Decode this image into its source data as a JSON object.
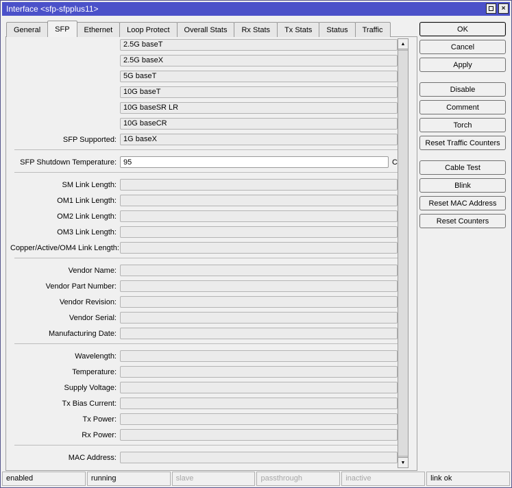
{
  "window": {
    "title": "Interface <sfp-sfpplus11>",
    "controls": {
      "close_glyph": "×"
    }
  },
  "icons": {
    "scroll_up": "▲",
    "scroll_down": "▼"
  },
  "tabs": {
    "active": "SFP",
    "items": [
      {
        "label": "General"
      },
      {
        "label": "SFP"
      },
      {
        "label": "Ethernet"
      },
      {
        "label": "Loop Protect"
      },
      {
        "label": "Overall Stats"
      },
      {
        "label": "Rx Stats"
      },
      {
        "label": "Tx Stats"
      },
      {
        "label": "Status"
      },
      {
        "label": "Traffic"
      }
    ]
  },
  "sfp": {
    "modes": [
      "2.5G baseT",
      "2.5G baseX",
      "5G baseT",
      "10G baseT",
      "10G baseSR LR",
      "10G baseCR"
    ],
    "supported": {
      "label": "SFP Supported:",
      "value": "1G baseX"
    },
    "shutdown_temperature": {
      "label": "SFP Shutdown Temperature:",
      "value": "95",
      "unit": "C"
    },
    "link_lengths": [
      {
        "label": "SM Link Length:",
        "value": ""
      },
      {
        "label": "OM1 Link Length:",
        "value": ""
      },
      {
        "label": "OM2 Link Length:",
        "value": ""
      },
      {
        "label": "OM3 Link Length:",
        "value": ""
      },
      {
        "label": "Copper/Active/OM4 Link Length:",
        "value": ""
      }
    ],
    "vendor": [
      {
        "label": "Vendor Name:",
        "value": ""
      },
      {
        "label": "Vendor Part Number:",
        "value": ""
      },
      {
        "label": "Vendor Revision:",
        "value": ""
      },
      {
        "label": "Vendor Serial:",
        "value": ""
      },
      {
        "label": "Manufacturing Date:",
        "value": ""
      }
    ],
    "diagnostics": [
      {
        "label": "Wavelength:",
        "value": ""
      },
      {
        "label": "Temperature:",
        "value": ""
      },
      {
        "label": "Supply Voltage:",
        "value": ""
      },
      {
        "label": "Tx Bias Current:",
        "value": ""
      },
      {
        "label": "Tx Power:",
        "value": ""
      },
      {
        "label": "Rx Power:",
        "value": ""
      }
    ],
    "mac_address": {
      "label": "MAC Address:",
      "value": ""
    }
  },
  "actions": {
    "group1": [
      {
        "label": "OK"
      },
      {
        "label": "Cancel"
      },
      {
        "label": "Apply"
      }
    ],
    "group2": [
      {
        "label": "Disable"
      },
      {
        "label": "Comment"
      },
      {
        "label": "Torch"
      },
      {
        "label": "Reset Traffic Counters"
      }
    ],
    "group3": [
      {
        "label": "Cable Test"
      },
      {
        "label": "Blink"
      },
      {
        "label": "Reset MAC Address"
      },
      {
        "label": "Reset Counters"
      }
    ]
  },
  "statusbar": {
    "cells": [
      {
        "label": "enabled",
        "active": true
      },
      {
        "label": "running",
        "active": true
      },
      {
        "label": "slave",
        "active": false
      },
      {
        "label": "passthrough",
        "active": false
      },
      {
        "label": "inactive",
        "active": false
      },
      {
        "label": "link ok",
        "active": true
      }
    ]
  },
  "colors": {
    "titlebar": "#4b51c9",
    "dialog_bg": "#f0f0f0",
    "field_bg": "#ebebeb",
    "dim_text": "#a6a6a6"
  }
}
